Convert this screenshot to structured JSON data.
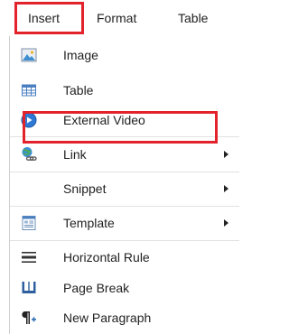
{
  "menubar": {
    "items": [
      {
        "label": "Insert"
      },
      {
        "label": "Format"
      },
      {
        "label": "Table"
      }
    ]
  },
  "dropdown": {
    "items": [
      {
        "label": "Image",
        "icon": "image-icon",
        "submenu": false
      },
      {
        "label": "Table",
        "icon": "table-icon",
        "submenu": false
      },
      {
        "label": "External Video",
        "icon": "video-icon",
        "submenu": false
      },
      {
        "label": "Link",
        "icon": "link-icon",
        "submenu": true
      },
      {
        "label": "Snippet",
        "icon": "",
        "submenu": true
      },
      {
        "label": "Template",
        "icon": "template-icon",
        "submenu": true
      },
      {
        "label": "Horizontal Rule",
        "icon": "horizontal-rule-icon",
        "submenu": false
      },
      {
        "label": "Page Break",
        "icon": "page-break-icon",
        "submenu": false
      },
      {
        "label": "New Paragraph",
        "icon": "new-paragraph-icon",
        "submenu": false
      }
    ]
  },
  "colors": {
    "highlight": "#e3232b",
    "icon_blue": "#2f6fb5",
    "icon_green": "#3a9a3a"
  }
}
